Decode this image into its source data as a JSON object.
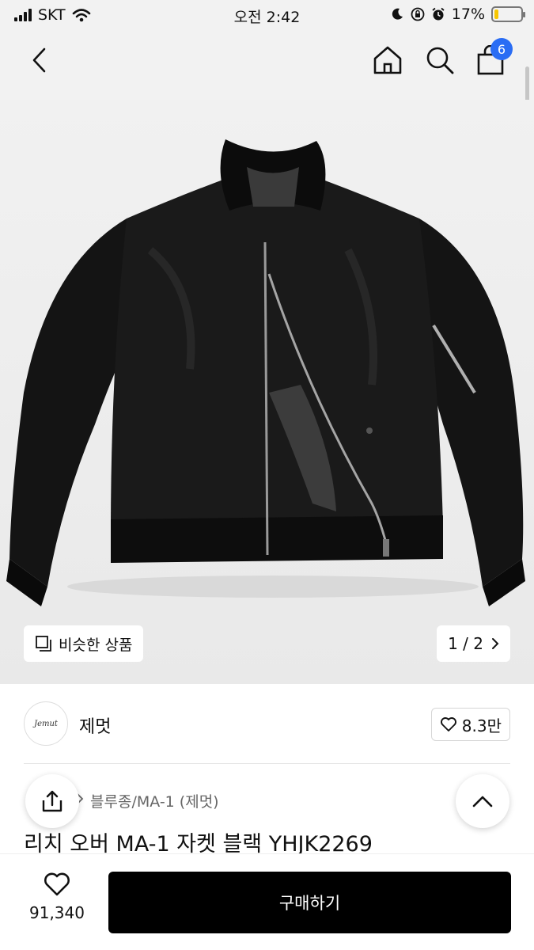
{
  "status_bar": {
    "carrier": "SKT",
    "time": "오전 2:42",
    "battery": "17%",
    "battery_level": 0.17
  },
  "nav": {
    "cart_count": "6"
  },
  "hero": {
    "similar_label": "비슷한 상품",
    "pager": "1 / 2"
  },
  "brand": {
    "logo_text": "Jemut",
    "name": "제멋",
    "likes": "8.3만"
  },
  "product": {
    "category": "블루종/MA-1 (제멋)",
    "title": "리치 오버 MA-1 자켓 블랙 YHJK2269"
  },
  "bottom": {
    "wish_count": "91,340",
    "buy_label": "구매하기"
  },
  "colors": {
    "accent": "#2a6df4",
    "buy_button": "#000000",
    "battery": "#f7c600"
  }
}
